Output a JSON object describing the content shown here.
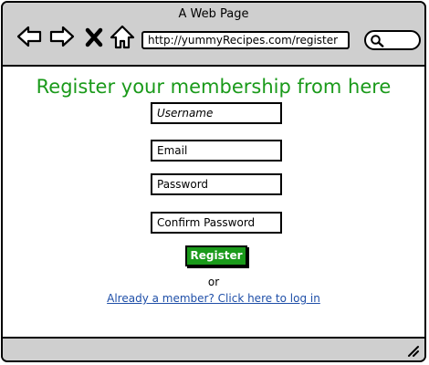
{
  "window": {
    "title": "A Web Page",
    "address": "http://yummyRecipes.com/register"
  },
  "icons": {
    "back": "arrow-left-icon",
    "forward": "arrow-right-icon",
    "stop": "close-icon",
    "home": "home-icon",
    "search": "search-icon",
    "resize": "resize-grip-icon"
  },
  "form": {
    "heading": "Register your membership from here",
    "username_placeholder": "Username",
    "email_placeholder": "Email",
    "password_placeholder": "Password",
    "confirm_placeholder": "Confirm Password",
    "register_label": "Register",
    "or_text": "or",
    "login_link": "Already a member? Click here to log in"
  },
  "colors": {
    "accent": "#1a9a1a",
    "link": "#1f4fa8",
    "chrome": "#cfcfcf"
  }
}
